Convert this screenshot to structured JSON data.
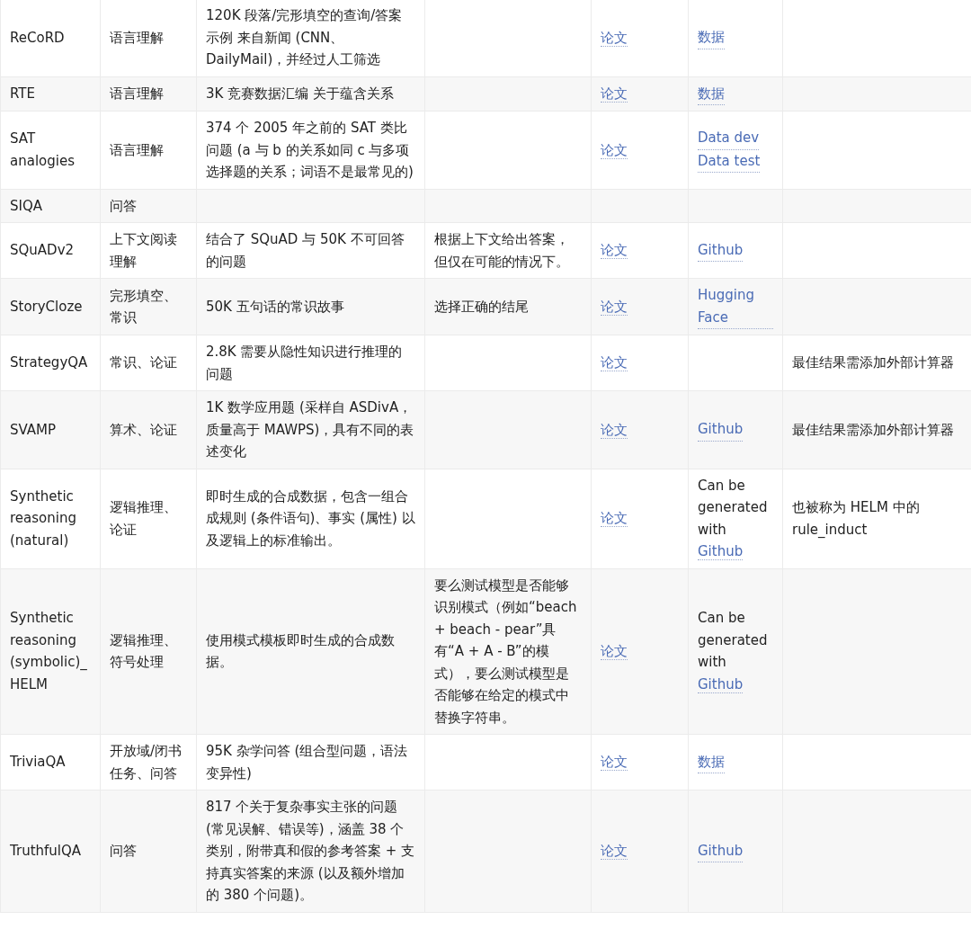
{
  "table": {
    "rows": [
      {
        "column_1": "ReCoRD",
        "column_2": "语言理解",
        "column_3": "120K 段落/完形填空的查询/答案示例 来自新闻 (CNN、DailyMail)，并经过人工筛选",
        "column_4": "",
        "column_5": "论文",
        "column_6": [
          {
            "kind": "link",
            "text": "数据"
          }
        ],
        "column_7": ""
      },
      {
        "column_1": "RTE",
        "column_2": "语言理解",
        "column_3": "3K 竞赛数据汇编 关于蕴含关系",
        "column_4": "",
        "column_5": "论文",
        "column_6": [
          {
            "kind": "link",
            "text": "数据"
          }
        ],
        "column_7": ""
      },
      {
        "column_1": "SAT analogies",
        "column_2": "语言理解",
        "column_3": "374 个 2005 年之前的 SAT 类比问题 (a 与 b 的关系如同 c 与多项选择题的关系；词语不是最常见的)",
        "column_4": "",
        "column_5": "论文",
        "column_6": [
          {
            "kind": "link",
            "text": "Data dev"
          },
          {
            "kind": "link",
            "text": "Data test"
          }
        ],
        "column_7": ""
      },
      {
        "column_1": "SIQA",
        "column_2": "问答",
        "column_3": "",
        "column_4": "",
        "column_5": "",
        "column_6": [],
        "column_7": ""
      },
      {
        "column_1": "SQuADv2",
        "column_2": "上下文阅读理解",
        "column_3": "结合了 SQuAD 与 50K 不可回答的问题",
        "column_4": "根据上下文给出答案，但仅在可能的情况下。",
        "column_5": "论文",
        "column_6": [
          {
            "kind": "link",
            "text": "Github"
          }
        ],
        "column_7": ""
      },
      {
        "column_1": "StoryCloze",
        "column_2": "完形填空、常识",
        "column_3": "50K 五句话的常识故事",
        "column_4": "选择正确的结尾",
        "column_5": "论文",
        "column_6": [
          {
            "kind": "link",
            "text": "Hugging Face"
          }
        ],
        "column_7": ""
      },
      {
        "column_1": "StrategyQA",
        "column_2": "常识、论证",
        "column_3": "2.8K 需要从隐性知识进行推理的问题",
        "column_4": "",
        "column_5": "论文",
        "column_6": [],
        "column_7": "最佳结果需添加外部计算器"
      },
      {
        "column_1": "SVAMP",
        "column_2": "算术、论证",
        "column_3": "1K 数学应用题 (采样自 ASDivA，质量高于 MAWPS)，具有不同的表述变化",
        "column_4": "",
        "column_5": "论文",
        "column_6": [
          {
            "kind": "link",
            "text": "Github"
          }
        ],
        "column_7": "最佳结果需添加外部计算器"
      },
      {
        "column_1": "Synthetic reasoning (natural)",
        "column_2": "逻辑推理、论证",
        "column_3": "即时生成的合成数据，包含一组合成规则 (条件语句)、事实 (属性) 以及逻辑上的标准输出。",
        "column_4": "",
        "column_5": "论文",
        "column_6": [
          {
            "kind": "text",
            "text": "Can be generated with"
          },
          {
            "kind": "link",
            "text": "Github"
          }
        ],
        "column_7": "也被称为 HELM 中的 rule_induct"
      },
      {
        "column_1": "Synthetic reasoning (symbolic)_ HELM",
        "column_2": "逻辑推理、符号处理",
        "column_3": "使用模式模板即时生成的合成数据。",
        "column_4": "要么测试模型是否能够识别模式（例如“beach + beach - pear”具有“A + A - B”的模式），要么测试模型是否能够在给定的模式中替换字符串。",
        "column_5": "论文",
        "column_6": [
          {
            "kind": "text",
            "text": "Can be generated with"
          },
          {
            "kind": "link",
            "text": "Github"
          }
        ],
        "column_7": ""
      },
      {
        "column_1": "TriviaQA",
        "column_2": "开放域/闭书任务、问答",
        "column_3": "95K 杂学问答 (组合型问题，语法变异性)",
        "column_4": "",
        "column_5": "论文",
        "column_6": [
          {
            "kind": "link",
            "text": "数据"
          }
        ],
        "column_7": ""
      },
      {
        "column_1": "TruthfulQA",
        "column_2": "问答",
        "column_3": "817 个关于复杂事实主张的问题 (常见误解、错误等)，涵盖 38 个类别，附带真和假的参考答案 + 支持真实答案的来源 (以及额外增加的 380 个问题)。",
        "column_4": "",
        "column_5": "论文",
        "column_6": [
          {
            "kind": "link",
            "text": "Github"
          }
        ],
        "column_7": ""
      }
    ]
  }
}
